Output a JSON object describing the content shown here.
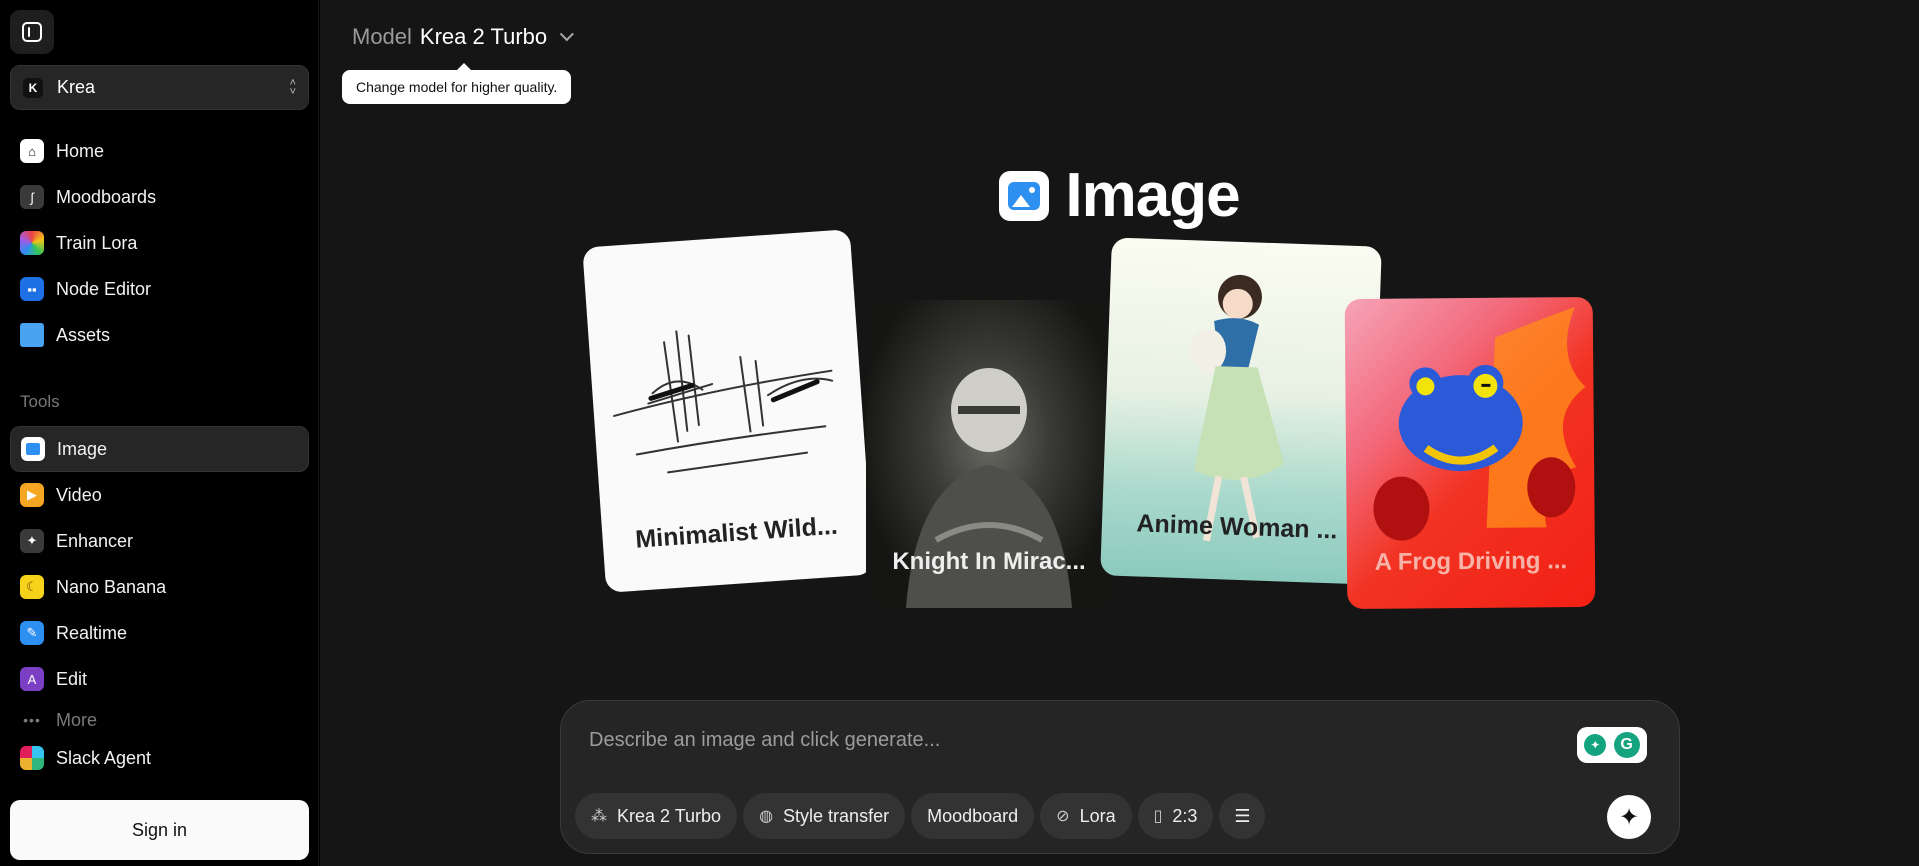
{
  "sidebar": {
    "workspace": {
      "logo": "K",
      "name": "Krea"
    },
    "nav": [
      {
        "label": "Home",
        "icon": "house-icon",
        "color": "#ffffff"
      },
      {
        "label": "Moodboards",
        "icon": "brush-icon",
        "color": "#3a3a3a"
      },
      {
        "label": "Train Lora",
        "icon": "rainbow-icon",
        "color": "#2b2b2b"
      },
      {
        "label": "Node Editor",
        "icon": "nodes-icon",
        "color": "#1f6fe5"
      },
      {
        "label": "Assets",
        "icon": "folder-icon",
        "color": "#4aa3f0"
      }
    ],
    "tools_label": "Tools",
    "tools": [
      {
        "label": "Image",
        "icon": "image-icon",
        "color": "#ffffff"
      },
      {
        "label": "Video",
        "icon": "video-icon",
        "color": "#f5a623"
      },
      {
        "label": "Enhancer",
        "icon": "wand-icon",
        "color": "#3a3a3a"
      },
      {
        "label": "Nano Banana",
        "icon": "banana-icon",
        "color": "#f7d21a"
      },
      {
        "label": "Realtime",
        "icon": "pen-icon",
        "color": "#2d8ff0"
      },
      {
        "label": "Edit",
        "icon": "edit-icon",
        "color": "#7b3fc4"
      }
    ],
    "more_label": "More",
    "slack_label": "Slack Agent",
    "signin_label": "Sign in"
  },
  "main": {
    "model_label": "Model",
    "model_value": "Krea 2 Turbo",
    "tooltip": "Change model for higher quality.",
    "title": "Image",
    "cards": [
      {
        "caption": "Minimalist Wild..."
      },
      {
        "caption": "Knight In Mirac..."
      },
      {
        "caption": "Anime Woman ..."
      },
      {
        "caption": "A Frog Driving ..."
      }
    ],
    "prompt_placeholder": "Describe an image and click generate...",
    "chips": {
      "model": "Krea 2 Turbo",
      "style": "Style transfer",
      "moodboard": "Moodboard",
      "lora": "Lora",
      "ratio": "2:3"
    }
  }
}
